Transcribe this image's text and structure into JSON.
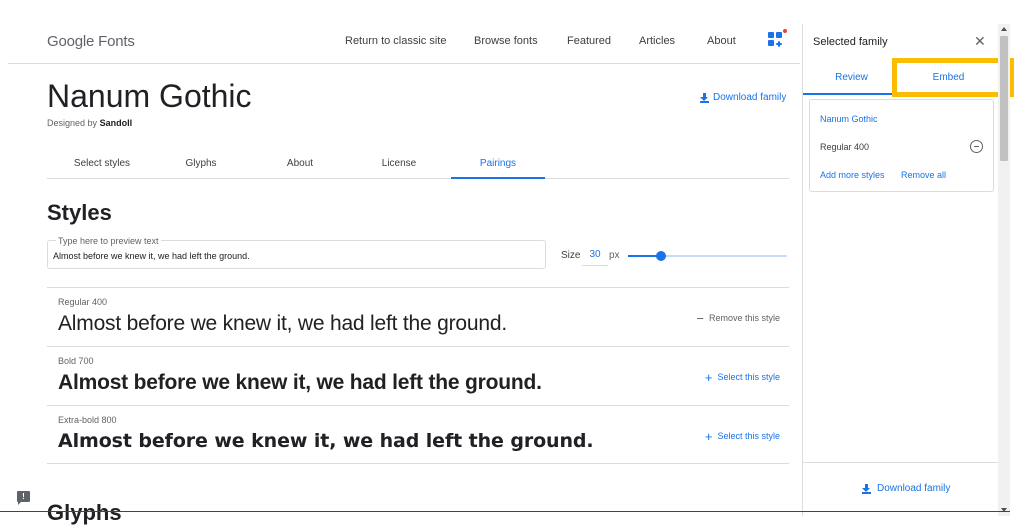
{
  "header": {
    "logo": "Google Fonts",
    "nav": [
      "Return to classic site",
      "Browse fonts",
      "Featured",
      "Articles",
      "About"
    ],
    "apps_icon": "apps-add-icon"
  },
  "font": {
    "title": "Nanum Gothic",
    "designed_by_prefix": "Designed by",
    "designer": "Sandoll",
    "download_label": "Download family"
  },
  "tabs": [
    {
      "label": "Select styles",
      "active": false
    },
    {
      "label": "Glyphs",
      "active": false
    },
    {
      "label": "About",
      "active": false
    },
    {
      "label": "License",
      "active": false
    },
    {
      "label": "Pairings",
      "active": true
    }
  ],
  "styles_section": {
    "heading": "Styles",
    "preview_label": "Type here to preview text",
    "preview_text": "Almost before we knew it, we had left the ground.",
    "size_label": "Size",
    "size_value": "30",
    "size_unit": "px",
    "size_slider_fraction": 0.21
  },
  "style_rows": [
    {
      "name": "Regular 400",
      "sample": "Almost before we knew it, we had left the ground.",
      "action": "Remove this style",
      "action_symbol": "−",
      "selected": true,
      "weight": 400
    },
    {
      "name": "Bold 700",
      "sample": "Almost before we knew it, we had left the ground.",
      "action": "Select this style",
      "action_symbol": "+",
      "selected": false,
      "weight": 700
    },
    {
      "name": "Extra-bold 800",
      "sample": "Almost before we knew it, we had left the ground.",
      "action": "Select this style",
      "action_symbol": "+",
      "selected": false,
      "weight": 800
    }
  ],
  "glyphs_heading": "Glyphs",
  "feedback_icon": "feedback-icon",
  "panel": {
    "title": "Selected family",
    "close_symbol": "✕",
    "tabs": [
      "Review",
      "Embed"
    ],
    "active_tab": "Review",
    "highlighted_tab": "Embed",
    "family_name": "Nanum Gothic",
    "family_style": "Regular 400",
    "add_more": "Add more styles",
    "remove_all": "Remove all",
    "download_label": "Download family"
  },
  "colors": {
    "accent": "#1a73e8",
    "highlight": "#fbbc04",
    "text": "#202124",
    "muted": "#5f6368",
    "border": "#dadce0"
  }
}
